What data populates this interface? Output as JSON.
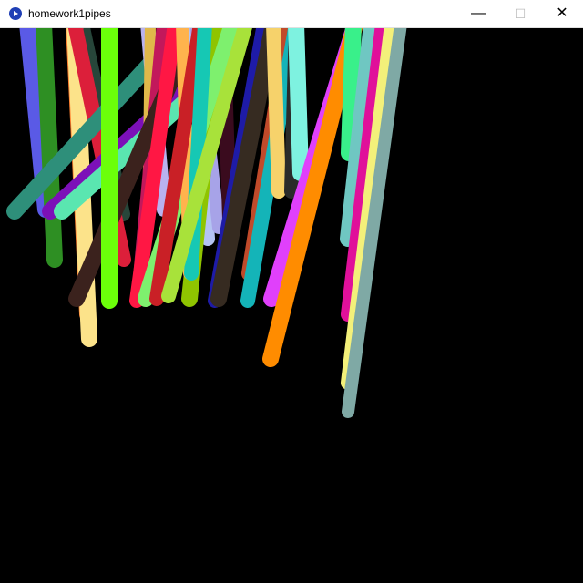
{
  "window": {
    "title": "homework1pipes",
    "app_icon": "processing-app-icon",
    "minimize_glyph": "—",
    "maximize_glyph": "☐",
    "close_glyph": "✕",
    "canvas_color": "#000000"
  },
  "pipe_colors": [
    "#5a5ae6",
    "#2e8f23",
    "#27463a",
    "#ff7f2f",
    "#fce38a",
    "#dc1f3a",
    "#2e8f7a",
    "#7c10b8",
    "#5ae6b0",
    "#b9b2ef",
    "#e0b84a",
    "#c2185b",
    "#3b221d",
    "#6bff0a",
    "#ff1744",
    "#b4c3f2",
    "#a7a3e8",
    "#3a0b1e",
    "#8fc400",
    "#7ef06e",
    "#ffb34d",
    "#c92026",
    "#16c8b4",
    "#a8e23a",
    "#1e1ba7",
    "#362b21",
    "#c04a2a",
    "#14b4b8",
    "#f6d26b",
    "#2a2b2a",
    "#7ef2e0",
    "#e040fb",
    "#ff8c00",
    "#39f08a",
    "#6fc7c2",
    "#e0109a",
    "#f3f07a",
    "#7fa9a5"
  ]
}
